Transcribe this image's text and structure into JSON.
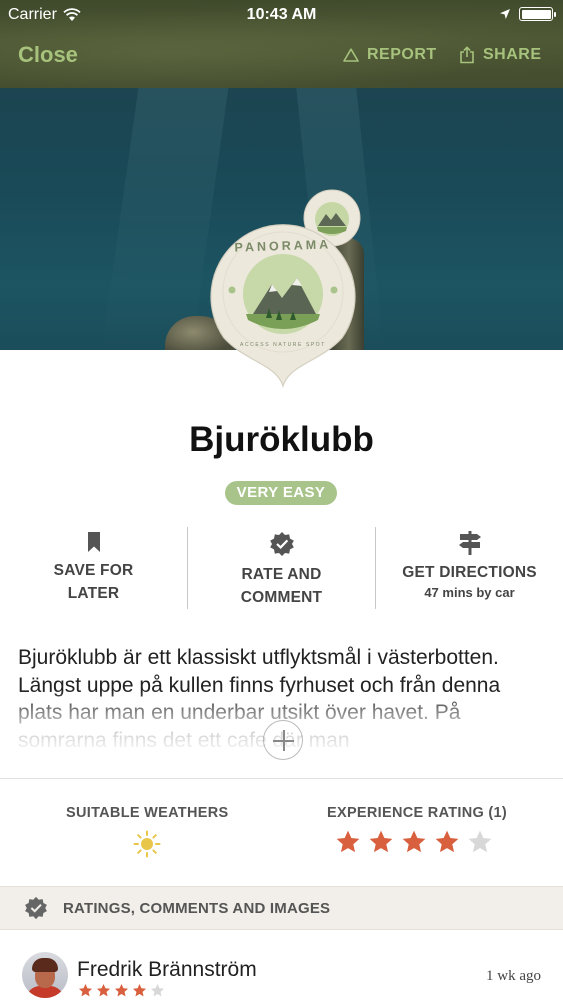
{
  "status_bar": {
    "carrier": "Carrier",
    "time": "10:43 AM"
  },
  "nav": {
    "close_label": "Close",
    "report_label": "REPORT",
    "share_label": "SHARE"
  },
  "badge": {
    "arc_text": "PANORAMA",
    "bottom_text": "ACCESS NATURE SPOT"
  },
  "place": {
    "title": "Bjuröklubb",
    "difficulty": "VERY EASY"
  },
  "actions": {
    "save_line1": "SAVE FOR",
    "save_line2": "LATER",
    "rate_line1": "RATE AND",
    "rate_line2": "COMMENT",
    "directions_label": "GET DIRECTIONS",
    "directions_sub": "47 mins by car"
  },
  "description": "Bjuröklubb är ett klassiskt utflyktsmål i västerbotten. Längst uppe på kullen finns fyrhuset och från denna plats har man en underbar utsikt över havet. På somrarna finns det ett cafe där man",
  "stats": {
    "weather_label": "SUITABLE WEATHERS",
    "weather_icons": [
      "sun-icon"
    ],
    "rating_label": "EXPERIENCE RATING (1)",
    "rating_value": 4,
    "rating_max": 5
  },
  "comments_section": {
    "title": "RATINGS, COMMENTS AND IMAGES"
  },
  "comments": [
    {
      "name": "Fredrik Brännström",
      "time": "1 wk ago",
      "rating": 4,
      "rating_max": 5
    }
  ],
  "colors": {
    "accent_green": "#a6c27c",
    "difficulty_bg": "#a8c48a",
    "star_filled": "#d9603f",
    "star_empty": "#d8d8d8",
    "sun": "#e8c64a"
  }
}
